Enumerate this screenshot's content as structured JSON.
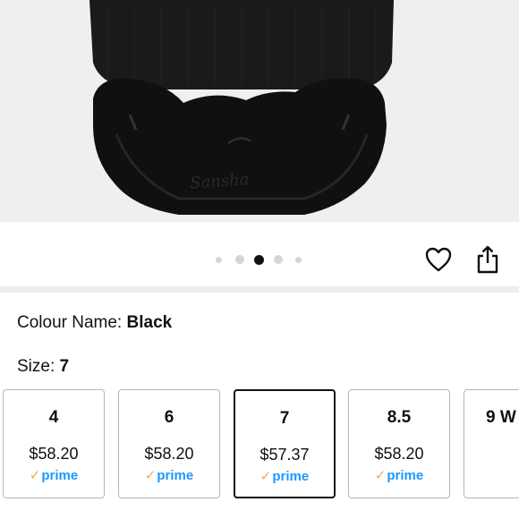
{
  "product": {
    "image_alt": "Black dance sneaker heel",
    "brand_mark": "Sansha"
  },
  "carousel": {
    "dot_count": 5,
    "active_index": 2
  },
  "actions": {
    "favorite_icon": "heart-icon",
    "share_icon": "share-icon"
  },
  "colour": {
    "label": "Colour Name: ",
    "value": "Black"
  },
  "size": {
    "label": "Size: ",
    "value": "7"
  },
  "sizes": [
    {
      "size": "4",
      "price": "$58.20",
      "prime_check": "✓",
      "prime_text": "prime"
    },
    {
      "size": "6",
      "price": "$58.20",
      "prime_check": "✓",
      "prime_text": "prime"
    },
    {
      "size": "7",
      "price": "$57.37",
      "prime_check": "✓",
      "prime_text": "prime",
      "selected": true
    },
    {
      "size": "8.5",
      "price": "$58.20",
      "prime_check": "✓",
      "prime_text": "prime"
    },
    {
      "size": "9 W"
    }
  ],
  "colors": {
    "prime_blue": "#1a98ff",
    "prime_check": "#f3a847",
    "selected_border": "#111111"
  }
}
